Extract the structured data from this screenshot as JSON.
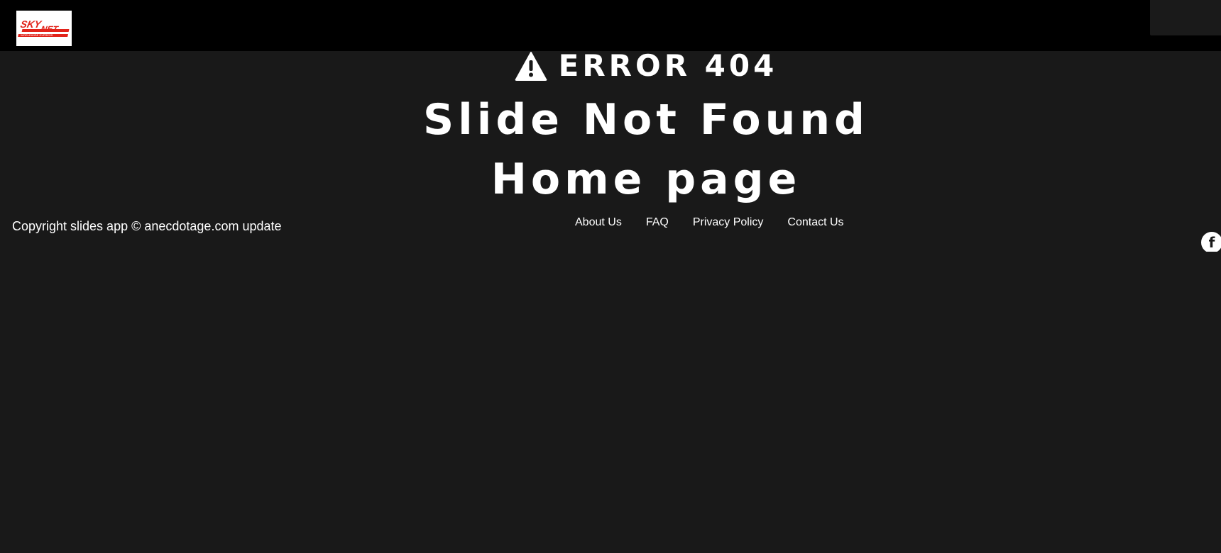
{
  "header": {
    "logo_alt": "SKYNET Worldwide Express",
    "logo_text_top": "SKY",
    "logo_text_bottom": "NET",
    "logo_tagline": "WORLDWIDE EXPRESS"
  },
  "error": {
    "icon": "warning-triangle-icon",
    "label": "ERROR 404"
  },
  "main": {
    "title": "Slide Not Found",
    "home_link": "Home page"
  },
  "footer": {
    "copyright": "Copyright slides app © anecdotage.com update",
    "links": [
      "About Us",
      "FAQ",
      "Privacy Policy",
      "Contact Us"
    ],
    "social_icon": "facebook-icon",
    "social_glyph": "f"
  },
  "colors": {
    "background": "#191919",
    "topbar": "#000000",
    "text": "#ffffff",
    "logo_red": "#e2231a"
  }
}
